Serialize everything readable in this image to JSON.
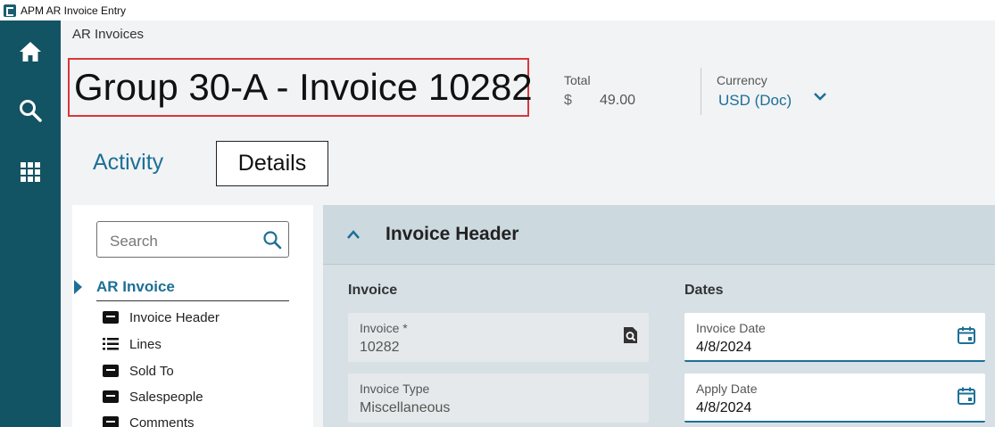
{
  "window": {
    "title": "APM AR Invoice Entry"
  },
  "rail": {
    "items": [
      "home",
      "search",
      "apps"
    ]
  },
  "breadcrumb": "AR Invoices",
  "page_title": "Group 30-A - Invoice 10282",
  "summary": {
    "total_label": "Total",
    "total_currency": "$",
    "total_value": "49.00",
    "currency_label": "Currency",
    "currency_value": "USD (Doc)"
  },
  "tabs": {
    "activity": "Activity",
    "details": "Details"
  },
  "sidenav": {
    "search_placeholder": "Search",
    "section": "AR Invoice",
    "items": [
      {
        "label": "Invoice Header",
        "icon": "document-icon"
      },
      {
        "label": "Lines",
        "icon": "list-icon"
      },
      {
        "label": "Sold To",
        "icon": "document-icon"
      },
      {
        "label": "Salespeople",
        "icon": "document-icon"
      },
      {
        "label": "Comments",
        "icon": "document-icon"
      }
    ]
  },
  "panel": {
    "title": "Invoice Header",
    "invoice_group": "Invoice",
    "dates_group": "Dates",
    "fields": {
      "invoice": {
        "label": "Invoice *",
        "value": "10282"
      },
      "invoice_type": {
        "label": "Invoice Type",
        "value": "Miscellaneous"
      },
      "invoice_date": {
        "label": "Invoice Date",
        "value": "4/8/2024"
      },
      "apply_date": {
        "label": "Apply Date",
        "value": "4/8/2024"
      }
    }
  },
  "colors": {
    "rail": "#125364",
    "accent": "#1d6f96",
    "title_highlight": "#d9373a"
  }
}
